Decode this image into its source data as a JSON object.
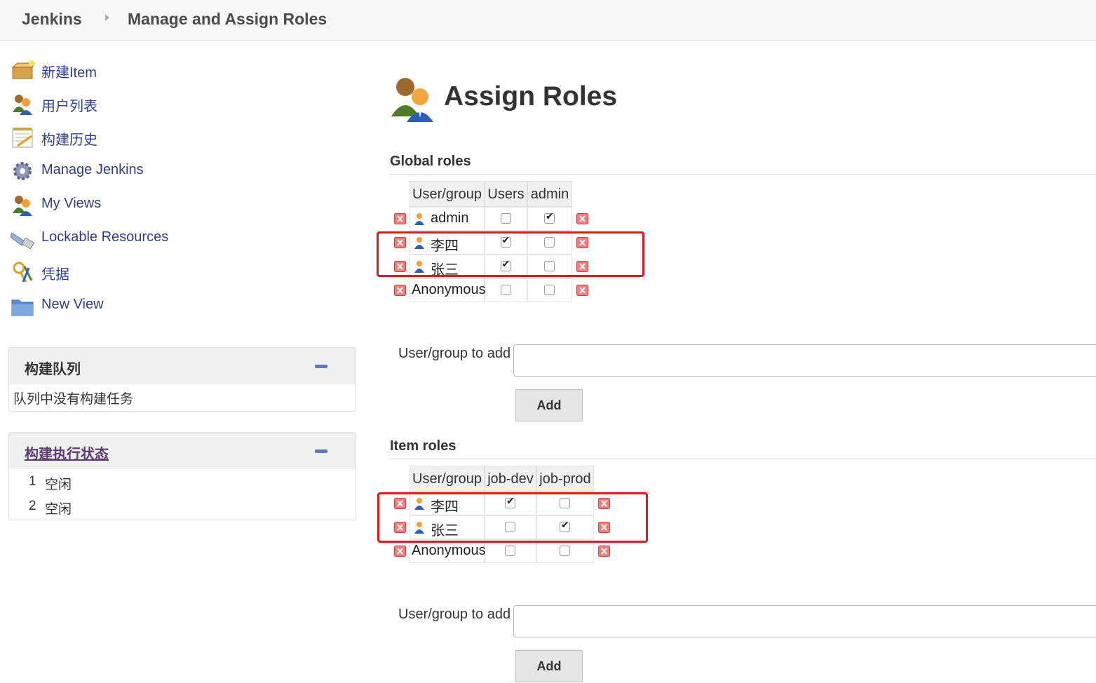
{
  "breadcrumb": {
    "home": "Jenkins",
    "page": "Manage and Assign Roles"
  },
  "sidebar": {
    "items": [
      {
        "label": "新建Item",
        "icon": "new-item-icon"
      },
      {
        "label": "用户列表",
        "icon": "people-icon"
      },
      {
        "label": "构建历史",
        "icon": "notepad-icon"
      },
      {
        "label": "Manage Jenkins",
        "icon": "gear-icon"
      },
      {
        "label": "My Views",
        "icon": "people-icon"
      },
      {
        "label": "Lockable Resources",
        "icon": "usb-icon"
      },
      {
        "label": "凭据",
        "icon": "keys-icon"
      },
      {
        "label": "New View",
        "icon": "folder-icon"
      }
    ]
  },
  "queue": {
    "title": "构建队列",
    "empty": "队列中没有构建任务"
  },
  "executors": {
    "title": "构建执行状态",
    "items": [
      {
        "num": "1",
        "status": "空闲"
      },
      {
        "num": "2",
        "status": "空闲"
      }
    ]
  },
  "main": {
    "title": "Assign Roles"
  },
  "global_roles": {
    "heading": "Global roles",
    "columns": [
      "User/group",
      "Users",
      "admin"
    ],
    "rows": [
      {
        "name": "admin",
        "user_icon": true,
        "checks": [
          false,
          true
        ]
      },
      {
        "name": "李四",
        "user_icon": true,
        "checks": [
          true,
          false
        ]
      },
      {
        "name": "张三",
        "user_icon": true,
        "checks": [
          true,
          false
        ]
      },
      {
        "name": "Anonymous",
        "user_icon": false,
        "checks": [
          false,
          false
        ]
      }
    ],
    "add_label": "User/group to add",
    "add_value": "",
    "add_button": "Add"
  },
  "item_roles": {
    "heading": "Item roles",
    "columns": [
      "User/group",
      "job-dev",
      "job-prod"
    ],
    "rows": [
      {
        "name": "李四",
        "user_icon": true,
        "checks": [
          true,
          false
        ]
      },
      {
        "name": "张三",
        "user_icon": true,
        "checks": [
          false,
          true
        ]
      },
      {
        "name": "Anonymous",
        "user_icon": false,
        "checks": [
          false,
          false
        ]
      }
    ],
    "add_label": "User/group to add",
    "add_value": "",
    "add_button": "Add"
  },
  "colors": {
    "link": "#2d3e85",
    "highlight": "#e8151b",
    "delete": "#e05555"
  }
}
